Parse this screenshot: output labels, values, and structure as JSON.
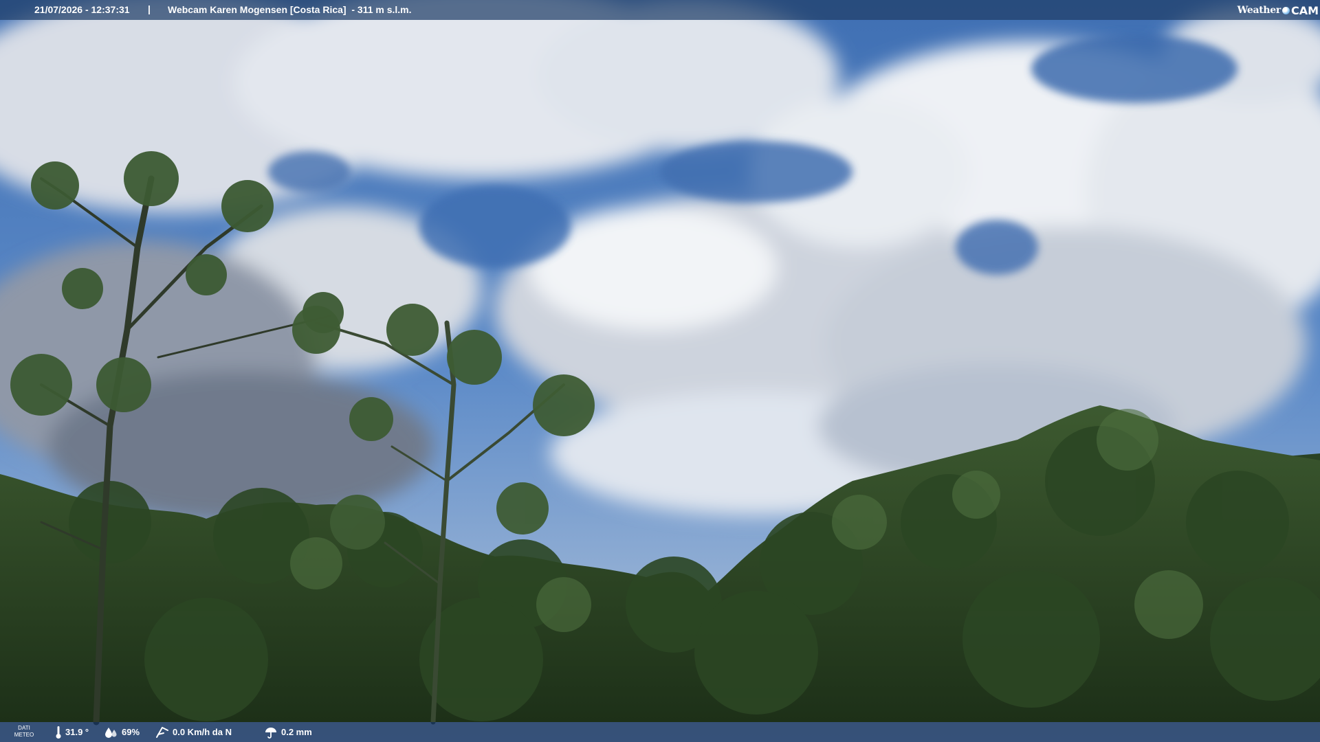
{
  "header": {
    "timestamp": "21/07/2026 - 12:37:31",
    "separator": "|",
    "title": "Webcam Karen Mogensen [Costa Rica]  - 311 m s.l.m.",
    "logo": {
      "text_weather": "Weather",
      "text_cam": "CAM"
    }
  },
  "footer": {
    "label_line1": "DATI",
    "label_line2": "METEO",
    "temperature": "31.9 °",
    "humidity": "69%",
    "wind": "0.0 Km/h da N",
    "rain": "0.2 mm",
    "icons": [
      "thermometer-icon",
      "humidity-icon",
      "wind-icon",
      "rain-icon"
    ]
  },
  "colors": {
    "sky": "#4f7fc4",
    "cloud": "#e8ecf2",
    "forest": "#2f4a28",
    "bar": "#1e3e68"
  }
}
